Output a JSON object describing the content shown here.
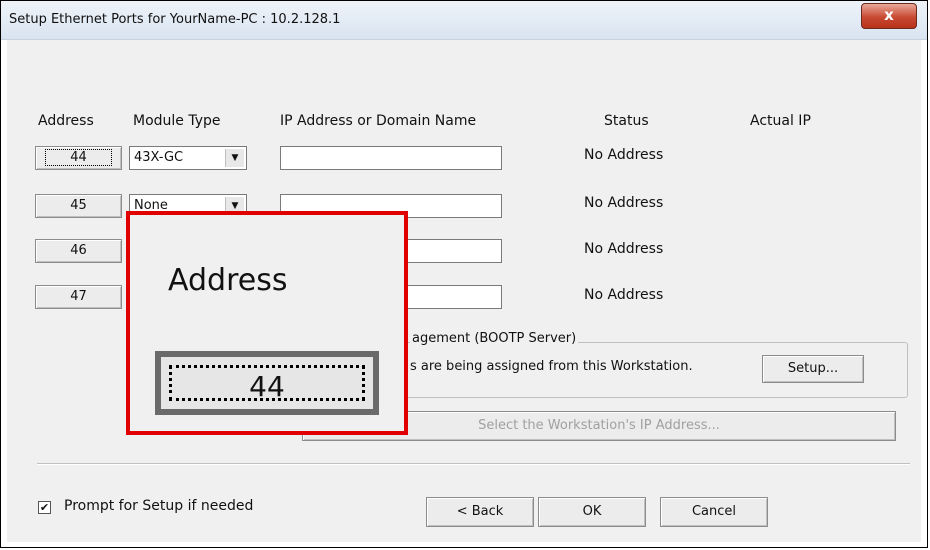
{
  "window": {
    "title": "Setup Ethernet Ports for YourName-PC : 10.2.128.1",
    "close_label": "x"
  },
  "columns": {
    "address": "Address",
    "module_type": "Module Type",
    "ip": "IP Address or Domain Name",
    "status": "Status",
    "actual_ip": "Actual IP"
  },
  "rows": [
    {
      "address": "44",
      "module": "43X-GC",
      "ip": "",
      "status": "No Address"
    },
    {
      "address": "45",
      "module": "None",
      "ip": "",
      "status": "No Address"
    },
    {
      "address": "46",
      "module": "",
      "ip": "",
      "status": "No Address"
    },
    {
      "address": "47",
      "module": "",
      "ip": "",
      "status": "No Address"
    }
  ],
  "bootp": {
    "group_label": "agement (BOOTP Server)",
    "text": "s are being assigned from this Workstation.",
    "setup_label": "Setup...",
    "select_ip_label": "Select the Workstation's IP Address..."
  },
  "footer": {
    "prompt_label": "Prompt for Setup if needed",
    "prompt_checked": true,
    "back_label": "< Back",
    "ok_label": "OK",
    "cancel_label": "Cancel"
  },
  "zoom": {
    "title": "Address",
    "value": "44",
    "border_color": "#e00000"
  }
}
